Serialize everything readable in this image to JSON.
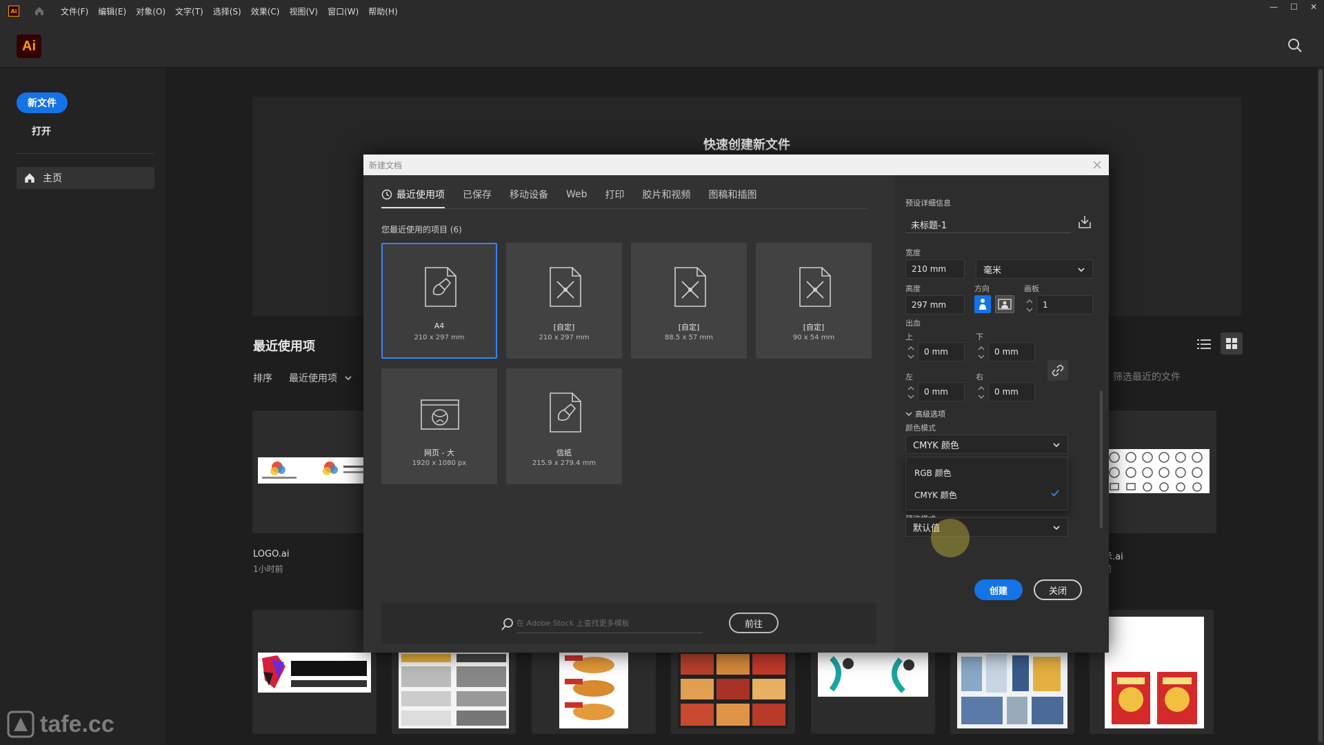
{
  "menubar": {
    "mini_logo": "Ai",
    "menus": [
      "文件(F)",
      "编辑(E)",
      "对象(O)",
      "文字(T)",
      "选择(S)",
      "效果(C)",
      "视图(V)",
      "窗口(W)",
      "帮助(H)"
    ],
    "window_controls": [
      "—",
      "☐",
      "✕"
    ]
  },
  "app": {
    "logo": "Ai",
    "search_icon": "search-icon"
  },
  "sidebar": {
    "new_file": "新文件",
    "open": "打开",
    "home": "主页"
  },
  "home": {
    "hero_title": "快速创建新文件",
    "recent_title": "最近使用项",
    "sort_label": "排序",
    "sort_value": "最近使用项",
    "filter_placeholder": "筛选最近的文件",
    "files": [
      {
        "name": "LOGO.ai",
        "time": "1小时前"
      },
      {
        "name": "示.ai",
        "time": "前"
      }
    ],
    "watermark": "tafe.cc"
  },
  "dialog": {
    "title": "新建文档",
    "tabs": [
      "最近使用项",
      "已保存",
      "移动设备",
      "Web",
      "打印",
      "胶片和视频",
      "图稿和插图"
    ],
    "recent_label": "您最近使用的项目 (6)",
    "presets": [
      {
        "name": "A4",
        "size": "210 x 297 mm",
        "icon": "brush-doc-icon",
        "selected": true
      },
      {
        "name": "[自定]",
        "size": "210 x 297 mm",
        "icon": "custom-doc-icon"
      },
      {
        "name": "[自定]",
        "size": "88.5 x 57 mm",
        "icon": "custom-doc-icon"
      },
      {
        "name": "[自定]",
        "size": "90 x 54 mm",
        "icon": "custom-doc-icon"
      },
      {
        "name": "网页 - 大",
        "size": "1920 x 1080 px",
        "icon": "web-doc-icon"
      },
      {
        "name": "信纸",
        "size": "215.9 x 279.4 mm",
        "icon": "brush-doc-icon"
      }
    ],
    "stock_placeholder": "在 Adobe Stock 上查找更多模板",
    "go_button": "前往",
    "details": {
      "section_title": "预设详细信息",
      "doc_name": "未标题-1",
      "width_label": "宽度",
      "width_value": "210 mm",
      "unit": "毫米",
      "height_label": "高度",
      "height_value": "297 mm",
      "orientation_label": "方向",
      "artboards_label": "画板",
      "artboards_value": "1",
      "bleed_label": "出血",
      "top_label": "上",
      "top_value": "0 mm",
      "bottom_label": "下",
      "bottom_value": "0 mm",
      "left_label": "左",
      "left_value": "0 mm",
      "right_label": "右",
      "right_value": "0 mm",
      "advanced": "高级选项",
      "color_mode_label": "颜色模式",
      "color_mode_value": "CMYK 颜色",
      "color_options": [
        "RGB 颜色",
        "CMYK 颜色"
      ],
      "preview_label": "预览模式",
      "preview_value": "默认值"
    },
    "create_button": "创建",
    "close_button": "关闭"
  },
  "colors": {
    "accent": "#1473e6",
    "brand": "#ff9a00",
    "selected_border": "#3b82f6"
  }
}
